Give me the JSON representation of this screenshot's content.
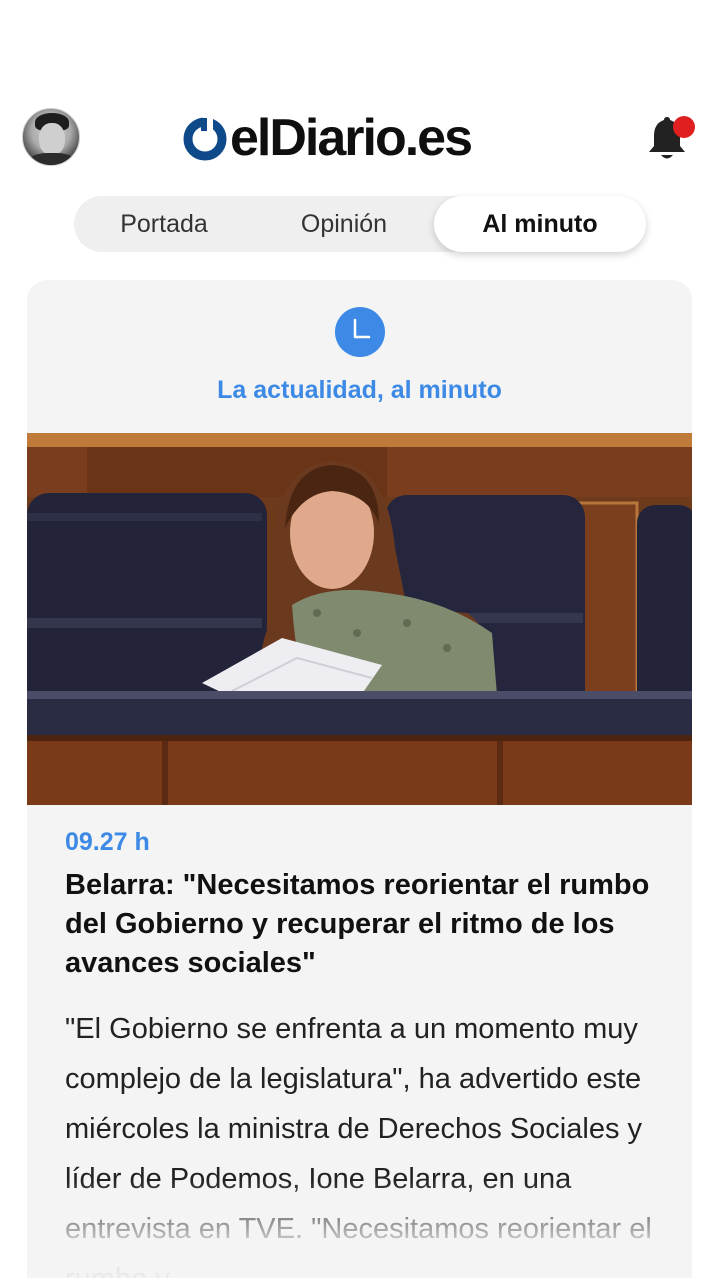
{
  "header": {
    "logo_text": "elDiario.es",
    "brand_color": "#0e4a8a",
    "notification_dot_color": "#e02020"
  },
  "tabs": [
    {
      "label": "Portada"
    },
    {
      "label": "Opinión"
    },
    {
      "label": "Al minuto",
      "active": true
    }
  ],
  "card": {
    "icon": "clock-icon",
    "tagline": "La actualidad, al minuto",
    "accent_color": "#3d8ae6",
    "photo_alt": "Belarra",
    "time": "09.27 h",
    "headline": "Belarra: \"Necesitamos reorientar el rumbo del Gobierno y recuperar el ritmo de los avances sociales\"",
    "body": "\"El Gobierno se enfrenta a un momento muy complejo de la legislatura\", ha advertido este miércoles la ministra de Derechos Sociales y líder de Podemos, Ione Belarra, en una entrevista en TVE. \"Necesitamos reorientar el rumbo y"
  }
}
